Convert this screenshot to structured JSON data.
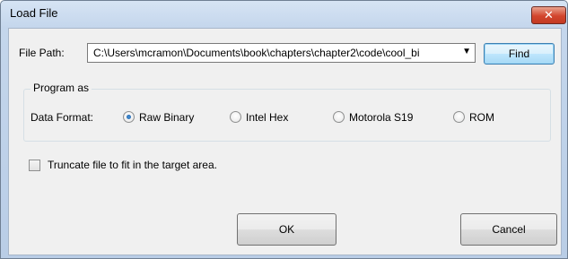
{
  "window": {
    "title": "Load File",
    "close_glyph": "✕"
  },
  "file_path": {
    "label": "File Path:",
    "value": "C:\\Users\\mcramon\\Documents\\book\\chapters\\chapter2\\code\\cool_bi",
    "dropdown_glyph": "▼",
    "find_label": "Find"
  },
  "program_group": {
    "legend": "Program as",
    "data_format_label": "Data Format:",
    "options": [
      {
        "label": "Raw Binary",
        "checked": true
      },
      {
        "label": "Intel Hex",
        "checked": false
      },
      {
        "label": "Motorola S19",
        "checked": false
      },
      {
        "label": "ROM",
        "checked": false
      }
    ]
  },
  "truncate": {
    "label": "Truncate file to fit in the target area.",
    "checked": false
  },
  "buttons": {
    "ok": "OK",
    "cancel": "Cancel"
  },
  "colors": {
    "title_bar": "#c4d6ec",
    "close_button": "#d2452d",
    "dialog_background": "#f0f0f0",
    "focus_accent": "#3c7fb1"
  },
  "icons": {
    "close": "close-icon",
    "dropdown": "chevron-down-icon"
  }
}
